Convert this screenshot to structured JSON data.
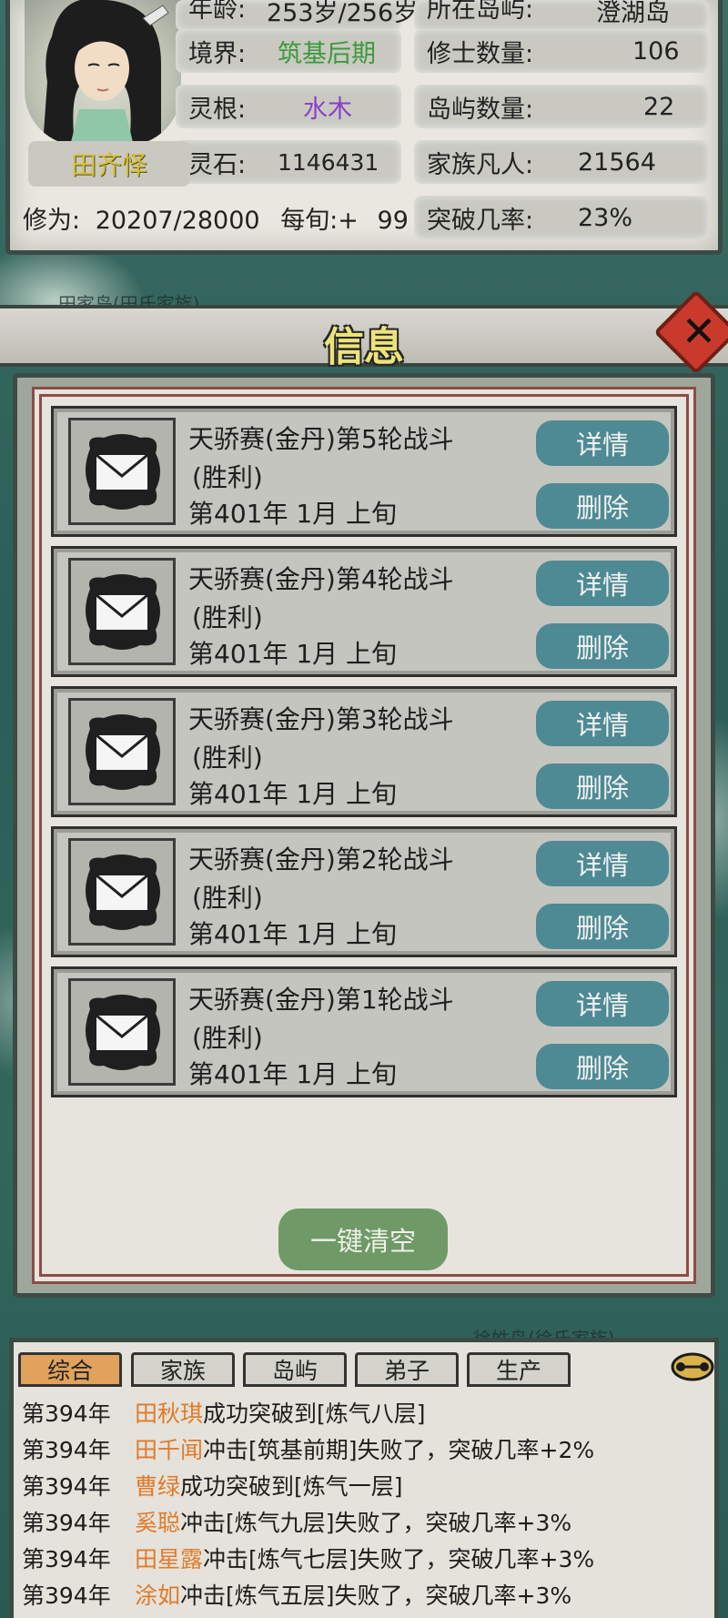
{
  "character": {
    "name": "田齐怿",
    "age_label": "年龄:",
    "age_value": "253岁/256岁",
    "location_label": "所在岛屿:",
    "location_value": "澄湖岛",
    "realm_label": "境界:",
    "realm_value": "筑基后期",
    "root_label": "灵根:",
    "root_value": "水木",
    "stones_label": "灵石:",
    "stones_value": "1146431",
    "cultivators_label": "修士数量:",
    "cultivators_value": "106",
    "islands_label": "岛屿数量:",
    "islands_value": "22",
    "mortals_label": "家族凡人:",
    "mortals_value": "21564",
    "cultivation_label": "修为:",
    "cultivation_value": "20207/28000",
    "per_xun_label": "每旬:+",
    "per_xun_value": "99",
    "breakthrough_label": "突破几率:",
    "breakthrough_value": "23%"
  },
  "map": {
    "label_top": "田家岛(田氏家族)",
    "label_bottom": "徐姓岛(徐氏家族)"
  },
  "dialog": {
    "title": "信息",
    "close_icon": "close-x-icon",
    "messages": [
      {
        "title": "天骄赛(金丹)第5轮战斗",
        "result": "(胜利)",
        "date": "第401年 1月 上旬",
        "detail_label": "详情",
        "delete_label": "删除"
      },
      {
        "title": "天骄赛(金丹)第4轮战斗",
        "result": "(胜利)",
        "date": "第401年 1月 上旬",
        "detail_label": "详情",
        "delete_label": "删除"
      },
      {
        "title": "天骄赛(金丹)第3轮战斗",
        "result": "(胜利)",
        "date": "第401年 1月 上旬",
        "detail_label": "详情",
        "delete_label": "删除"
      },
      {
        "title": "天骄赛(金丹)第2轮战斗",
        "result": "(胜利)",
        "date": "第401年 1月 上旬",
        "detail_label": "详情",
        "delete_label": "删除"
      },
      {
        "title": "天骄赛(金丹)第1轮战斗",
        "result": "(胜利)",
        "date": "第401年 1月 上旬",
        "detail_label": "详情",
        "delete_label": "删除"
      }
    ],
    "clear_all_label": "一键清空"
  },
  "log": {
    "tabs": [
      "综合",
      "家族",
      "岛屿",
      "弟子",
      "生产"
    ],
    "active_tab": "综合",
    "name_color": "#e07b2a",
    "entries": [
      {
        "year": "第394年",
        "name": "田秋琪",
        "text": "成功突破到[炼气八层]"
      },
      {
        "year": "第394年",
        "name": "田千闻",
        "text": "冲击[筑基前期]失败了，突破几率+2%"
      },
      {
        "year": "第394年",
        "name": "曹绿",
        "text": "成功突破到[炼气一层]"
      },
      {
        "year": "第394年",
        "name": "奚聪",
        "text": "冲击[炼气九层]失败了，突破几率+3%"
      },
      {
        "year": "第394年",
        "name": "田星露",
        "text": "冲击[炼气七层]失败了，突破几率+3%"
      },
      {
        "year": "第394年",
        "name": "涂如",
        "text": "冲击[炼气五层]失败了，突破几率+3%"
      }
    ]
  }
}
